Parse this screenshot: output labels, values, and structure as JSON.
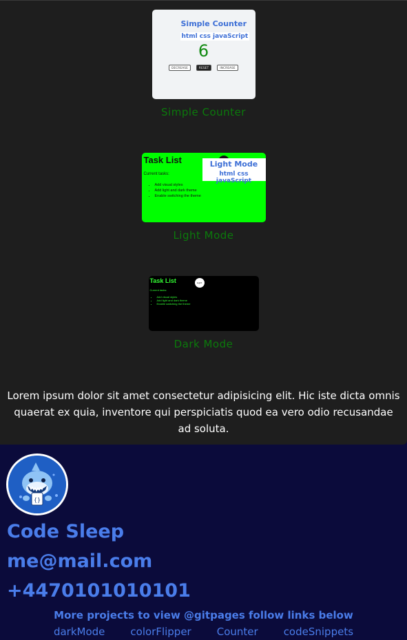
{
  "projects": [
    {
      "caption": "Simple Counter",
      "thumb": {
        "overlay_title": "Simple Counter",
        "overlay_subtitle": "html css javaScript",
        "count": "6",
        "buttons": [
          "DECREASE",
          "RESET",
          "INCREASE"
        ]
      }
    },
    {
      "caption": "Light Mode",
      "thumb": {
        "title": "Task List",
        "subtitle": "Current tasks:",
        "items": [
          "Add visual styles",
          "Add light and dark theme",
          "Enable switching the theme"
        ],
        "overlay_title": "Light Mode",
        "overlay_subtitle": "html css javaScript"
      }
    },
    {
      "caption": "Dark Mode",
      "thumb": {
        "title": "Task List",
        "subtitle": "Current tasks:",
        "items": [
          "Add visual styles",
          "Add light and dark theme",
          "Enable switching the theme"
        ],
        "toggle_label": "Light"
      }
    }
  ],
  "description": "Lorem ipsum dolor sit amet consectetur adipisicing elit. Hic iste dicta omnis quaerat ex quia, inventore qui perspiciatis quod ea vero odio recusandae ad soluta.",
  "footer": {
    "avatar_icon": "shark-mascot-icon",
    "name": "Code Sleep",
    "email": "me@mail.com",
    "phone": "+4470101010101",
    "more_text": "More projects to view @gitpages follow links below",
    "links": [
      "darkMode",
      "colorFlipper",
      "Counter",
      "codeSnippets"
    ]
  },
  "colors": {
    "page_bg": "#1e1e1e",
    "footer_bg": "#0b0b3b",
    "caption_green": "#0b7a0b",
    "link_blue": "#4a7dea",
    "light_thumb_bg": "#00ff00"
  }
}
